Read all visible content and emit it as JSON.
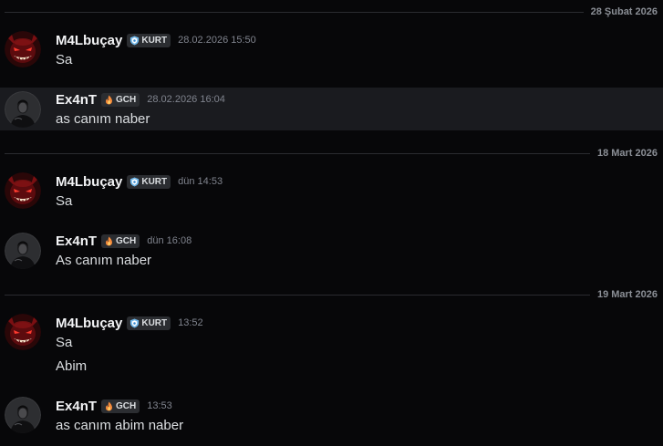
{
  "dates": [
    "28 Şubat 2026",
    "18 Mart 2026",
    "19 Mart 2026"
  ],
  "users": {
    "m4l": {
      "name": "M4Lbuçay",
      "tag": "KURT",
      "tag_icon": "shield-icon"
    },
    "ex4": {
      "name": "Ex4nT",
      "tag": "GCH",
      "tag_icon": "flame-icon"
    }
  },
  "messages": [
    {
      "user": "M4Lbuçay",
      "tag": "KURT",
      "time": "28.02.2026 15:50",
      "lines": [
        "Sa"
      ]
    },
    {
      "user": "Ex4nT",
      "tag": "GCH",
      "time": "28.02.2026 16:04",
      "lines": [
        "as canım naber"
      ]
    },
    {
      "user": "M4Lbuçay",
      "tag": "KURT",
      "time": "dün 14:53",
      "lines": [
        "Sa"
      ]
    },
    {
      "user": "Ex4nT",
      "tag": "GCH",
      "time": "dün 16:08",
      "lines": [
        "As canım naber"
      ]
    },
    {
      "user": "M4Lbuçay",
      "tag": "KURT",
      "time": "13:52",
      "lines": [
        "Sa",
        "Abim"
      ]
    },
    {
      "user": "Ex4nT",
      "tag": "GCH",
      "time": "13:53",
      "lines": [
        "as canım abim naber"
      ]
    }
  ]
}
